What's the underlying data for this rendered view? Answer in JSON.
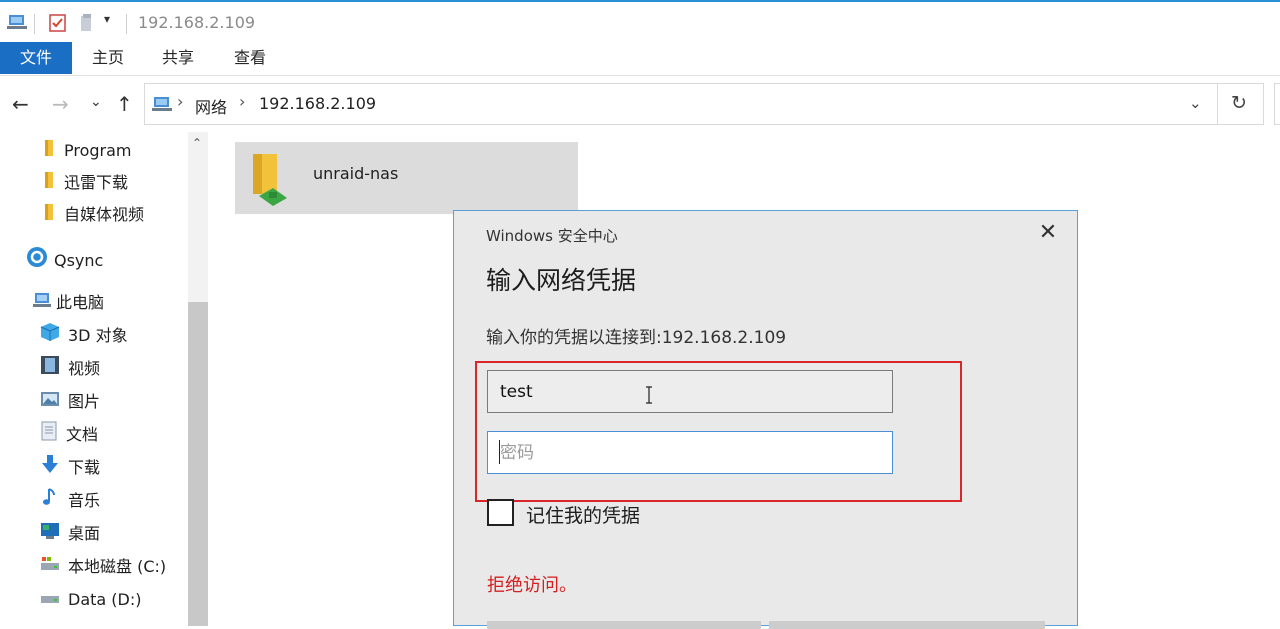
{
  "window": {
    "title": "192.168.2.109",
    "accent_color": "#1a6fc4"
  },
  "ribbon": {
    "tabs": [
      {
        "label": "文件"
      },
      {
        "label": "主页"
      },
      {
        "label": "共享"
      },
      {
        "label": "查看"
      }
    ]
  },
  "address": {
    "breadcrumbs": [
      "网络",
      "192.168.2.109"
    ]
  },
  "sidebar": {
    "items": [
      {
        "label": "Program",
        "icon": "folder-icon"
      },
      {
        "label": "迅雷下载",
        "icon": "folder-icon"
      },
      {
        "label": "自媒体视频",
        "icon": "folder-icon"
      },
      {
        "label": "Qsync",
        "icon": "qsync-icon"
      },
      {
        "label": "此电脑",
        "icon": "computer-icon"
      },
      {
        "label": "3D 对象",
        "icon": "3d-objects-icon"
      },
      {
        "label": "视频",
        "icon": "videos-icon"
      },
      {
        "label": "图片",
        "icon": "pictures-icon"
      },
      {
        "label": "文档",
        "icon": "documents-icon"
      },
      {
        "label": "下载",
        "icon": "downloads-icon"
      },
      {
        "label": "音乐",
        "icon": "music-icon"
      },
      {
        "label": "桌面",
        "icon": "desktop-icon"
      },
      {
        "label": "本地磁盘 (C:)",
        "icon": "local-disk-icon"
      },
      {
        "label": "Data (D:)",
        "icon": "drive-icon"
      }
    ]
  },
  "content": {
    "items": [
      {
        "label": "unraid-nas",
        "icon": "network-share-icon"
      }
    ]
  },
  "dialog": {
    "caption": "Windows 安全中心",
    "heading": "输入网络凭据",
    "subtitle": "输入你的凭据以连接到:192.168.2.109",
    "username_value": "test",
    "password_placeholder": "密码",
    "remember_label": "记住我的凭据",
    "remember_checked": false,
    "error_text": "拒绝访问。",
    "error_color": "#d22020",
    "highlight_color": "#d9262b"
  }
}
